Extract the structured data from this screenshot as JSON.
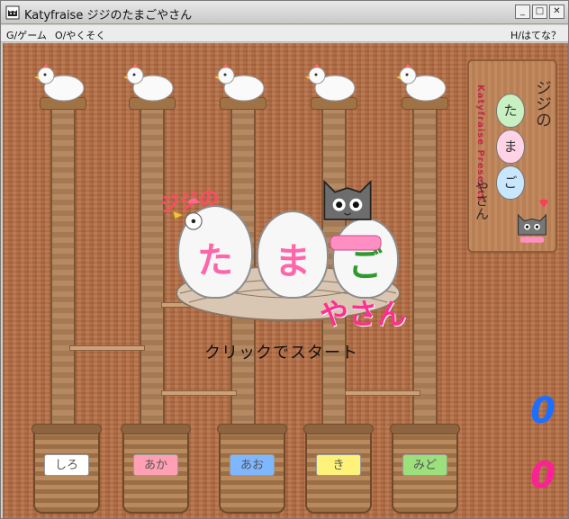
{
  "window": {
    "title": "Katyfraise ジジのたまごやさん"
  },
  "menu": {
    "left_items": [
      "G/ゲーム",
      "O/やくそく"
    ],
    "right_item": "H/はてな？"
  },
  "sign": {
    "title": "ジジの",
    "brand": "Katyfraise Presents",
    "eggs": [
      "た",
      "ま",
      "ご"
    ],
    "bottom": "やさん"
  },
  "logo": {
    "jiji": "ジジの",
    "egg_chars": [
      "た",
      "ま",
      "ご"
    ],
    "yasan": "やさん"
  },
  "start_prompt": "クリックでスタート",
  "baskets": [
    {
      "label": "しろ",
      "color": "#ffffff"
    },
    {
      "label": "あか",
      "color": "#ff9fb4"
    },
    {
      "label": "あお",
      "color": "#7fb7ff"
    },
    {
      "label": "き",
      "color": "#fff27a"
    },
    {
      "label": "みど",
      "color": "#9be07b"
    }
  ],
  "scores": {
    "blue": "0",
    "pink": "0",
    "blue_color": "#1d6fff",
    "pink_color": "#ff1f96"
  }
}
